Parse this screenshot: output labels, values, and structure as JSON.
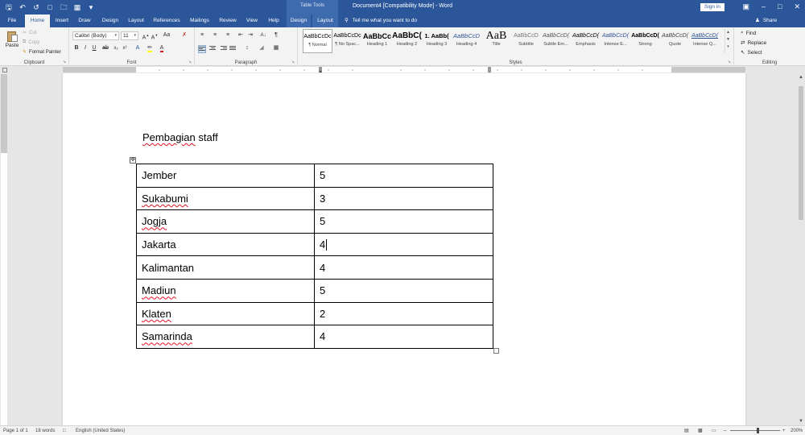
{
  "titlebar": {
    "title": "Document4 [Compatibility Mode] - Word",
    "context_tab_title": "Table Tools",
    "signin": "Sign in",
    "qat": [
      "save-icon",
      "undo-icon",
      "redo-icon",
      "new-doc-icon",
      "open-icon",
      "print-preview-icon",
      "customize-icon"
    ],
    "window_controls": [
      "ribbon-display-icon",
      "minimize-icon",
      "maximize-icon",
      "close-icon"
    ]
  },
  "tabs": [
    {
      "label": "File"
    },
    {
      "label": "Home"
    },
    {
      "label": "Insert"
    },
    {
      "label": "Draw"
    },
    {
      "label": "Design"
    },
    {
      "label": "Layout"
    },
    {
      "label": "References"
    },
    {
      "label": "Mailings"
    },
    {
      "label": "Review"
    },
    {
      "label": "View"
    },
    {
      "label": "Help"
    },
    {
      "label": "Design"
    },
    {
      "label": "Layout"
    }
  ],
  "tell_me": "Tell me what you want to do",
  "share": "Share",
  "ribbon": {
    "clipboard": {
      "label": "Clipboard",
      "paste": "Paste",
      "cut": "Cut",
      "copy": "Copy",
      "format_painter": "Format Painter"
    },
    "font": {
      "label": "Font",
      "font_name": "Calibri (Body)",
      "font_size": "11"
    },
    "paragraph": {
      "label": "Paragraph"
    },
    "styles": {
      "label": "Styles",
      "items": [
        {
          "preview": "AaBbCcDc",
          "name": "¶ Normal"
        },
        {
          "preview": "AaBbCcDc",
          "name": "¶ No Spac..."
        },
        {
          "preview": "AaBbCc",
          "name": "Heading 1"
        },
        {
          "preview": "AaBbC(",
          "name": "Heading 2"
        },
        {
          "preview": "1. AaBb(",
          "name": "Heading 3"
        },
        {
          "preview": "AaBbCcD",
          "name": "Heading 4"
        },
        {
          "preview": "AaB",
          "name": "Title"
        },
        {
          "preview": "AaBbCcD",
          "name": "Subtitle"
        },
        {
          "preview": "AaBbCcD(",
          "name": "Subtle Em..."
        },
        {
          "preview": "AaBbCcD(",
          "name": "Emphasis"
        },
        {
          "preview": "AaBbCcD(",
          "name": "Intense E..."
        },
        {
          "preview": "AaBbCcD(",
          "name": "Strong"
        },
        {
          "preview": "AaBbCcD(",
          "name": "Quote"
        },
        {
          "preview": "AaBbCcD(",
          "name": "Intense Q..."
        }
      ]
    },
    "editing": {
      "label": "Editing",
      "find": "Find",
      "replace": "Replace",
      "select": "Select"
    }
  },
  "document": {
    "heading_word1": "Pembagian",
    "heading_word2": "staff",
    "table": [
      {
        "city": "Jember",
        "count": "5",
        "squiggle": false
      },
      {
        "city": "Sukabumi",
        "count": "3",
        "squiggle": true
      },
      {
        "city": "Jogja",
        "count": "5",
        "squiggle": true
      },
      {
        "city": "Jakarta",
        "count": "4",
        "squiggle": false
      },
      {
        "city": "Kalimantan",
        "count": "4",
        "squiggle": false
      },
      {
        "city": "Madiun",
        "count": "5",
        "squiggle": true
      },
      {
        "city": "Klaten",
        "count": "2",
        "squiggle": true
      },
      {
        "city": "Samarinda",
        "count": "4",
        "squiggle": true
      }
    ]
  },
  "statusbar": {
    "page": "Page 1 of 1",
    "words": "18 words",
    "language": "English (United States)",
    "zoom": "200%"
  },
  "colors": {
    "title_bar": "#2b579a",
    "ribbon": "#f3f3f3",
    "canvas": "#e6e6e6",
    "spell_error": "#e81123"
  }
}
